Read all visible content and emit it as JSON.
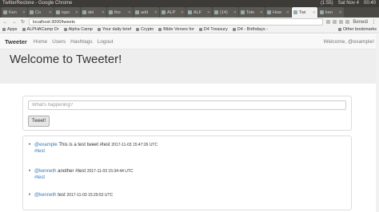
{
  "os_bar": {
    "title": "TwitterReclone - Google Chrome",
    "status": [
      "(1:55)",
      "Sat Nov 4",
      "00:40"
    ]
  },
  "tabs": [
    {
      "label": "Ken",
      "active": false
    },
    {
      "label": "Co",
      "active": false
    },
    {
      "label": "ispo",
      "active": false
    },
    {
      "label": "del",
      "active": false
    },
    {
      "label": "tho",
      "active": false
    },
    {
      "label": "add",
      "active": false
    },
    {
      "label": "ALP",
      "active": false
    },
    {
      "label": "ALF",
      "active": false
    },
    {
      "label": "(14)",
      "active": false
    },
    {
      "label": "Tele",
      "active": false
    },
    {
      "label": "How",
      "active": false
    },
    {
      "label": "Twi",
      "active": true
    },
    {
      "label": "ken",
      "active": false
    }
  ],
  "address_bar": {
    "url": "localhost:3000/tweets",
    "user": "Benedi"
  },
  "bookmarks": {
    "items": [
      "Apps",
      "ALPHACamp Dr",
      "Alpha Camp",
      "Your daily brief",
      "Crypto",
      "Bible Verses for",
      "D4 Treasury",
      "D4 - Birthdays -"
    ],
    "other": "Other bookmarks"
  },
  "navbar": {
    "brand": "Tweeter",
    "links": [
      "Home",
      "Users",
      "Hashtags",
      "Logout"
    ],
    "welcome": "Welcome, @example!"
  },
  "jumbotron": {
    "title": "Welcome to Tweeter!"
  },
  "form": {
    "placeholder": "What's happening?",
    "button": "Tweet!"
  },
  "tweets": [
    {
      "handle": "@example",
      "text": "This is a test tweet #test",
      "timestamp": "2017-11-03 15:47:26 UTC",
      "tag": "#test"
    },
    {
      "handle": "@kenneth",
      "text": "another #test",
      "timestamp": "2017-11-03 15:34:44 UTC",
      "tag": "#test"
    },
    {
      "handle": "@kenneth",
      "text": "test",
      "timestamp": "2017-11-03 15:29:52 UTC",
      "tag": ""
    }
  ]
}
